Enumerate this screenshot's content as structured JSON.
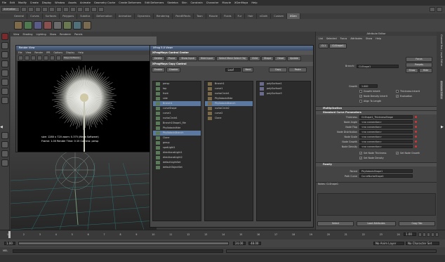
{
  "menubar": [
    "File",
    "Edit",
    "Modify",
    "Create",
    "Display",
    "Window",
    "Assets",
    "Animate",
    "Geometry Cache",
    "Create Deformers",
    "Edit Deformers",
    "Skeleton",
    "Skin",
    "Constrain",
    "Character",
    "Muscle",
    "XGenMaya",
    "Help"
  ],
  "status": {
    "mode": "Animation"
  },
  "shelf_tabs": [
    "General",
    "Curves",
    "Surfaces",
    "Polygons",
    "Subdivs",
    "Deformation",
    "Animation",
    "Dynamics",
    "Rendering",
    "PaintEffects",
    "Toon",
    "Muscle",
    "Fluids",
    "Fur",
    "Hair",
    "nCloth",
    "Custom",
    "XGen"
  ],
  "shelf_active": "XGen",
  "panel_menu": [
    "View",
    "Shading",
    "Lighting",
    "Show",
    "Renderer",
    "Panels"
  ],
  "render_view": {
    "title": "Render View",
    "menu": [
      "File",
      "View",
      "Render",
      "IPR",
      "Options",
      "Display",
      "Help"
    ],
    "renderer_label": "Maya Software",
    "stats_1": "size: 1280 x 720  zoom: 0.375     (Maya Software)",
    "stats_2": "Frame: 1.00      Render Time: 0:15      Camera: persp"
  },
  "xgen": {
    "title": "XFrog 5.0 Viewr",
    "control_header": "XFrogMaya Control Center",
    "control_buttons": [
      "Delete",
      "Prune",
      "Show Input",
      "Hide Input",
      "Select Mesh Select Obj",
      "Child",
      "Shape",
      "Head",
      "Update"
    ],
    "copy_header": "XFrogMaya Copy Control",
    "copy_buttons": [
      "Enable",
      "Disable"
    ],
    "copy_field": "Leaf",
    "copy_action": "Next",
    "copy_btn": "Copy",
    "paste_btn": "Paste",
    "outliner_1": [
      "persp",
      "top",
      "front",
      "side",
      "Branch1",
      "curveShape",
      "curve1",
      "nurbsCircle1",
      "Branch1Shape1_file",
      "PhyllotaxisHide",
      "PhyllotaxisBranch",
      "Clone",
      "group",
      "spotLight1",
      "directionalLight1",
      "directionalLight2",
      "defaultLightSet",
      "defaultObjectSet"
    ],
    "outliner_2": [
      "Branch1",
      "curve1",
      "nurbsCircle1",
      "PhyllotaxisHide",
      "PhyllotaxisBranch",
      "nurbsCircle2",
      "curve2",
      "Clone"
    ],
    "outliner_3": [
      "polySurface1",
      "polySurface2",
      "polySurface3"
    ]
  },
  "attr": {
    "title": "Attribute Editor",
    "menu": [
      "List",
      "Selected",
      "Focus",
      "Attributes",
      "Show",
      "Help"
    ],
    "tabs": [
      "CL1",
      "CLShape1"
    ],
    "branch_label": "Branch:",
    "branch_value": "CLShape1",
    "focus_btn": "Focus",
    "presets_btn": "Presets",
    "show_btn": "Show",
    "hide_btn": "Hide",
    "growth_label": "Growth",
    "growth_value": "1.000",
    "checks": [
      "Growth Inherit",
      "Thickness Inherit",
      "Node Density Inherit",
      "Evaluation",
      "Align To Length"
    ],
    "multiplication": "Multiplication",
    "std_params": "Standard Curve Parameters",
    "params": [
      {
        "label": "Thickness",
        "value": "CLShape1_ThicknessShape"
      },
      {
        "label": "Node Angle",
        "value": "<no connection>"
      },
      {
        "label": "Node Flap",
        "value": "<no connection>"
      },
      {
        "label": "Node Distribution",
        "value": "<no connection>"
      },
      {
        "label": "Node Scale",
        "value": "<no connection>"
      },
      {
        "label": "Node Growth",
        "value": "<no connection>"
      },
      {
        "label": "Node Density",
        "value": "<no connection>"
      }
    ],
    "checks2": [
      "Set Node Thickness",
      "Set Node Growth",
      "Set Node Density"
    ],
    "family": "Family",
    "parent_label": "Parent",
    "parent_value": "PhyllotaxisShape1",
    "path_label": "Path Curve",
    "path_value": "CurveNurbsShape1",
    "notes": "Notes: CLShape1",
    "footer_btns": [
      "Select",
      "Load Attributes",
      "Copy Tab"
    ]
  },
  "right_tabs": [
    "Channel Box / Layer Editor",
    "Attribute Editor"
  ],
  "time": {
    "ticks": [
      "1",
      "2",
      "3",
      "4",
      "5",
      "6",
      "7",
      "8",
      "9",
      "10",
      "11",
      "12",
      "13",
      "14",
      "15",
      "16",
      "17",
      "18",
      "19",
      "20",
      "21",
      "22",
      "23",
      "24"
    ],
    "current": "1.00",
    "start": "1.00",
    "end": "24.00",
    "range_end": "48.00",
    "anim_layer": "No Anim Layer",
    "char_set": "No Character Set"
  },
  "cmd": {
    "label": "MEL"
  }
}
